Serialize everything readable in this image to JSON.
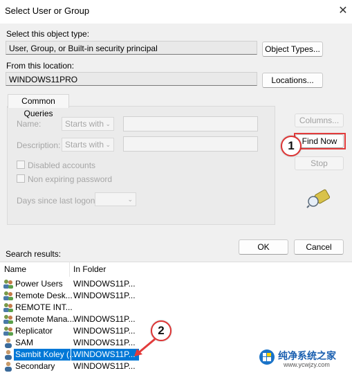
{
  "window": {
    "title": "Select User or Group",
    "close_glyph": "✕"
  },
  "object_type": {
    "label": "Select this object type:",
    "value": "User, Group, or Built-in security principal",
    "button": "Object Types..."
  },
  "location": {
    "label": "From this location:",
    "value": "WINDOWS11PRO",
    "button": "Locations..."
  },
  "common_queries": {
    "tab": "Common Queries",
    "name_label": "Name:",
    "name_mode": "Starts with",
    "description_label": "Description:",
    "description_mode": "Starts with",
    "disabled_accounts": "Disabled accounts",
    "non_expiring": "Non expiring password",
    "days_since": "Days since last logon:"
  },
  "side_buttons": {
    "columns": "Columns...",
    "find_now": "Find Now",
    "stop": "Stop"
  },
  "footer": {
    "search_results": "Search results:",
    "ok": "OK",
    "cancel": "Cancel"
  },
  "results": {
    "columns": [
      "Name",
      "In Folder"
    ],
    "rows": [
      {
        "name": "Power Users",
        "folder": "WINDOWS11P...",
        "icon": "group-icon"
      },
      {
        "name": "Remote Desk...",
        "folder": "WINDOWS11P...",
        "icon": "group-icon"
      },
      {
        "name": "REMOTE INT...",
        "folder": "",
        "icon": "group-icon"
      },
      {
        "name": "Remote Mana...",
        "folder": "WINDOWS11P...",
        "icon": "group-icon"
      },
      {
        "name": "Replicator",
        "folder": "WINDOWS11P...",
        "icon": "group-icon"
      },
      {
        "name": "SAM",
        "folder": "WINDOWS11P...",
        "icon": "user-icon"
      },
      {
        "name": "Sambit Koley (...",
        "folder": "WINDOWS11P...",
        "icon": "user-icon",
        "selected": true
      },
      {
        "name": "Secondary",
        "folder": "WINDOWS11P...",
        "icon": "user-icon"
      }
    ]
  },
  "annotations": {
    "step1": "1",
    "step2": "2"
  },
  "watermark": {
    "text": "纯净系统之家",
    "url": "www.ycwjzy.com"
  },
  "colors": {
    "selection": "#0078d7",
    "callout_red": "#e23b3b"
  }
}
